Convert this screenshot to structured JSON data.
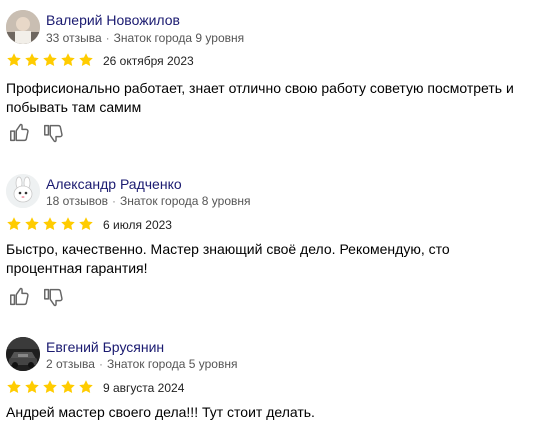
{
  "reviews": [
    {
      "author": "Валерий Новожилов",
      "reviews_count": "33 отзыва",
      "level": "Знаток города 9 уровня",
      "rating": 5,
      "date": "26 октября 2023",
      "text": "Профисионально работает, знает отлично свою работу советую посмотреть и побывать там самим",
      "avatar": "photo-avatar"
    },
    {
      "author": "Александр Радченко",
      "reviews_count": "18 отзывов",
      "level": "Знаток города 8 уровня",
      "rating": 5,
      "date": "6 июля 2023",
      "text": "Быстро, качественно. Мастер знающий своё дело. Рекомендую, сто процентная гарантия!",
      "avatar": "rabbit-avatar"
    },
    {
      "author": "Евгений Брусянин",
      "reviews_count": "2 отзыва",
      "level": "Знаток города 5 уровня",
      "rating": 5,
      "date": "9 августа 2024",
      "text": "Андрей мастер своего дела!!! Тут стоит делать.",
      "avatar": "car-avatar"
    }
  ],
  "colors": {
    "star": "#ffcc00",
    "author": "#1a1a70"
  }
}
